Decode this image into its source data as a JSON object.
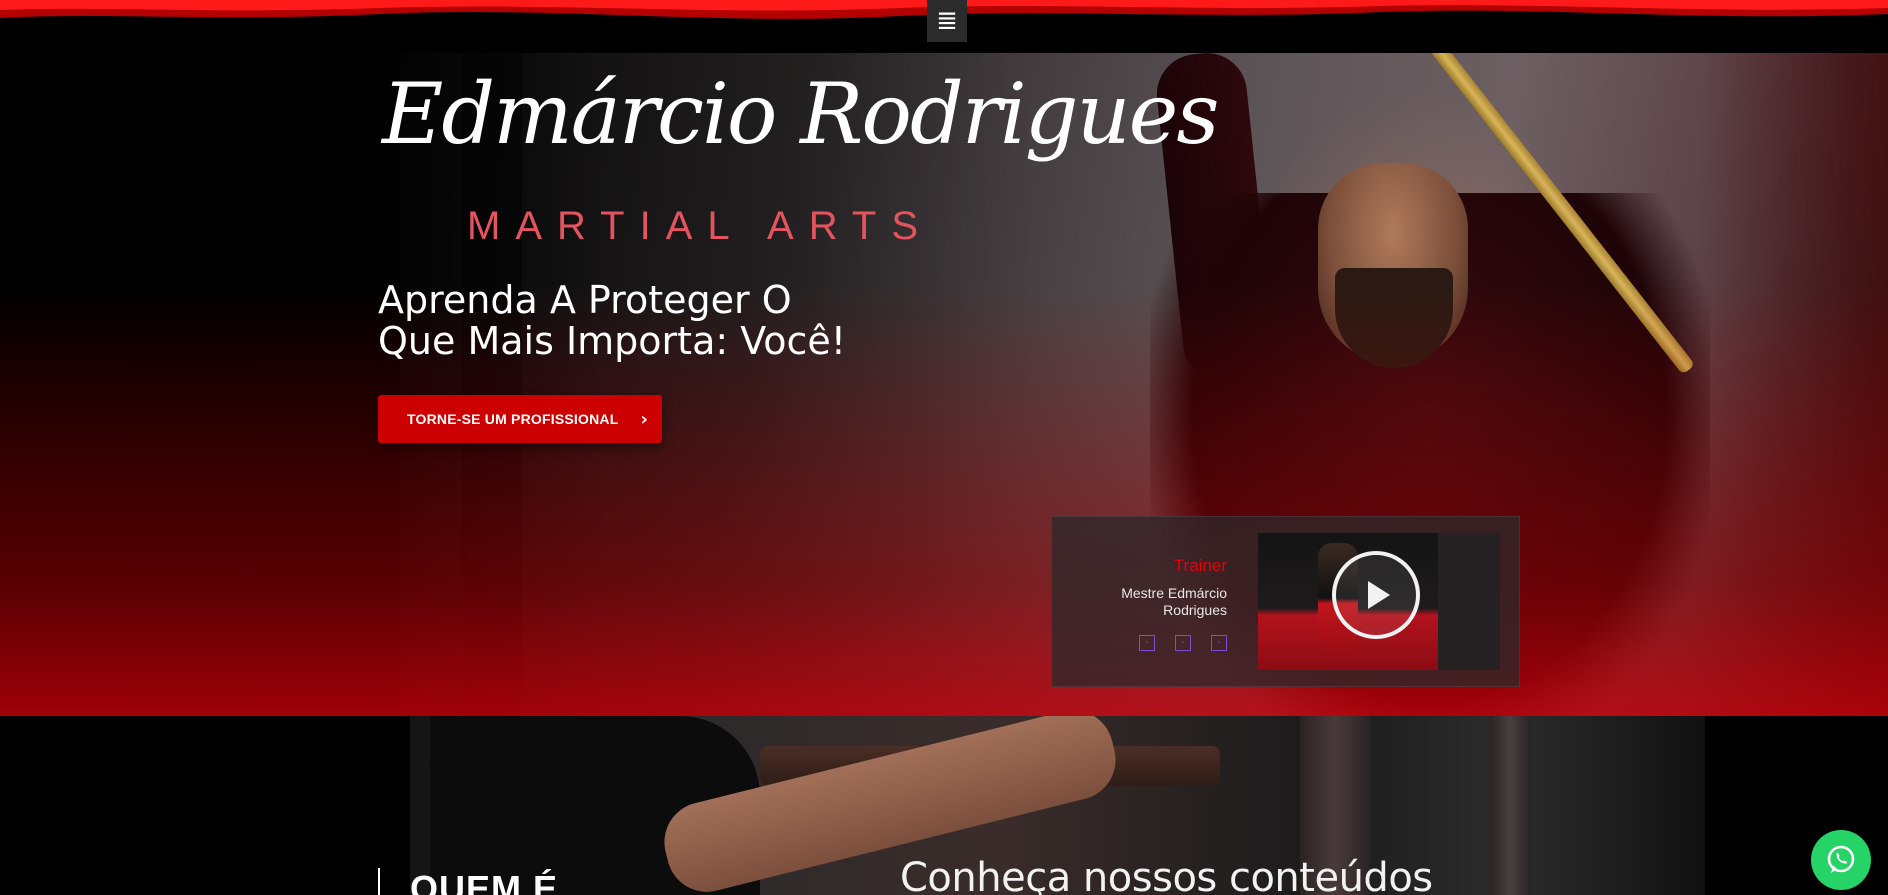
{
  "header": {
    "menu_icon": "hamburger-menu-icon",
    "menu_glyph": "≣"
  },
  "hero": {
    "logo_script": "Edmárcio Rodrigues",
    "logo_sub": "MARTIAL ARTS",
    "headline_line1": "Aprenda A Proteger O",
    "headline_line2": "Que Mais Importa: Você!",
    "cta_label": "TORNE-SE UM PROFISSIONAL",
    "cta_arrow": "›",
    "cta_color": "#cc0000"
  },
  "trainer_card": {
    "title": "Trainer",
    "name": "Mestre Edmárcio Rodrigues",
    "socials": [
      {
        "icon": "social-icon",
        "glyph": "\u0001"
      },
      {
        "icon": "social-icon",
        "glyph": "\u0001"
      },
      {
        "icon": "social-icon",
        "glyph": "\u0001"
      }
    ],
    "video_icon": "play-icon"
  },
  "lower": {
    "quem_title": "QUEM É",
    "conheca_title": "Conheça nossos conteúdos"
  },
  "whatsapp": {
    "icon": "whatsapp-icon",
    "color": "#25d366"
  },
  "colors": {
    "accent_red": "#cc0000",
    "logo_sub_color": "#e35460",
    "trainer_title_color": "#e8000a"
  }
}
